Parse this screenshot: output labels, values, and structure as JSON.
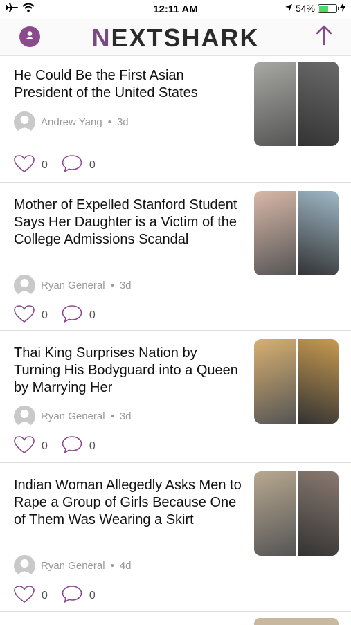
{
  "status_bar": {
    "time": "12:11 AM",
    "battery_percent": "54%",
    "battery_level": 0.54,
    "icons": [
      "airplane-icon",
      "wifi-icon",
      "location-icon",
      "battery-icon",
      "charging-icon"
    ]
  },
  "header": {
    "logo_initial": "N",
    "logo_rest": "EXTSHARK",
    "brand_color": "#7a4a84"
  },
  "articles": [
    {
      "title": "He Could Be the First Asian President of the United States",
      "author": "Andrew Yang",
      "age": "3d",
      "likes": "0",
      "comments": "0",
      "colors": [
        "#a8a8a4",
        "#6a6a6a"
      ]
    },
    {
      "title": "Mother of Expelled Stanford Student Says Her Daughter is a Victim of the College Admissions Scandal",
      "author": "Ryan General",
      "age": "3d",
      "likes": "0",
      "comments": "0",
      "colors": [
        "#d9b8a8",
        "#9fb8c8"
      ]
    },
    {
      "title": "Thai King Surprises Nation by Turning His Bodyguard into a Queen by Marrying Her",
      "author": "Ryan General",
      "age": "3d",
      "likes": "0",
      "comments": "0",
      "colors": [
        "#d8b070",
        "#c89a50"
      ]
    },
    {
      "title": "Indian Woman Allegedly Asks Men to Rape a Group of Girls Because One of Them Was Wearing a Skirt",
      "author": "Ryan General",
      "age": "4d",
      "likes": "0",
      "comments": "0",
      "colors": [
        "#b8a890",
        "#8a7a70"
      ]
    }
  ]
}
